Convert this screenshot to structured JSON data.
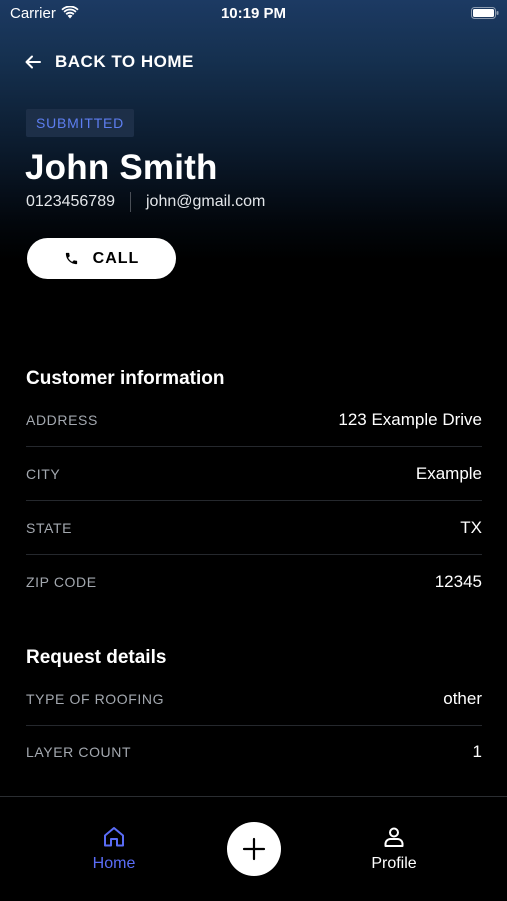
{
  "status_bar": {
    "carrier": "Carrier",
    "time": "10:19 PM"
  },
  "header": {
    "back_label": "BACK TO HOME",
    "status_badge": "SUBMITTED",
    "customer_name": "John Smith",
    "phone": "0123456789",
    "email": "john@gmail.com",
    "call_label": "CALL"
  },
  "customer_information": {
    "title": "Customer information",
    "rows": [
      {
        "label": "ADDRESS",
        "value": "123 Example Drive"
      },
      {
        "label": "CITY",
        "value": "Example"
      },
      {
        "label": "STATE",
        "value": "TX"
      },
      {
        "label": "ZIP CODE",
        "value": "12345"
      }
    ]
  },
  "request_details": {
    "title": "Request details",
    "rows": [
      {
        "label": "TYPE OF ROOFING",
        "value": "other"
      },
      {
        "label": "LAYER COUNT",
        "value": "1"
      }
    ]
  },
  "tab_bar": {
    "home_label": "Home",
    "profile_label": "Profile",
    "active_tab": "Home"
  },
  "colors": {
    "accent": "#5a6cf6",
    "badge_text": "#5d7ef0",
    "badge_bg": "#1d2f48",
    "background": "#000000",
    "header_gradient_top": "#1c3a63"
  },
  "icons": {
    "back": "arrow-left-icon",
    "call": "phone-icon",
    "home": "home-icon",
    "add": "plus-icon",
    "profile": "user-icon",
    "wifi": "wifi-icon",
    "battery": "battery-icon"
  }
}
